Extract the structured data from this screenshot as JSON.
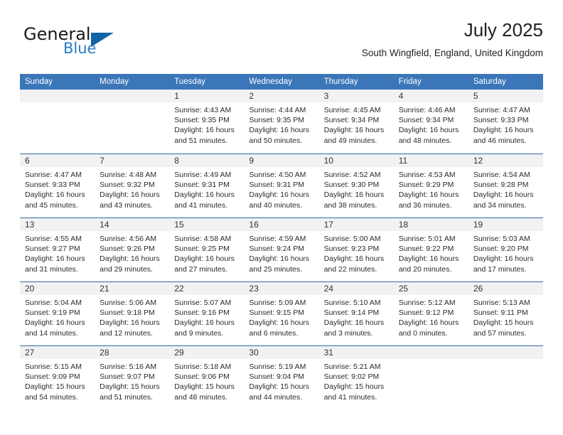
{
  "brand": {
    "name_part1": "General",
    "name_part2": "Blue"
  },
  "header": {
    "title": "July 2025",
    "subtitle": "South Wingfield, England, United Kingdom"
  },
  "colors": {
    "header_blue": "#3b76b9",
    "brand_blue": "#2b7cc4",
    "triangle_blue": "#1263a4",
    "numband_gray": "#f2f2f2",
    "week_rule": "#2e6aa8"
  },
  "weekdays": [
    "Sunday",
    "Monday",
    "Tuesday",
    "Wednesday",
    "Thursday",
    "Friday",
    "Saturday"
  ],
  "weeks": [
    [
      {
        "day": "",
        "sunrise": "",
        "sunset": "",
        "daylight1": "",
        "daylight2": ""
      },
      {
        "day": "",
        "sunrise": "",
        "sunset": "",
        "daylight1": "",
        "daylight2": ""
      },
      {
        "day": "1",
        "sunrise": "Sunrise: 4:43 AM",
        "sunset": "Sunset: 9:35 PM",
        "daylight1": "Daylight: 16 hours",
        "daylight2": "and 51 minutes."
      },
      {
        "day": "2",
        "sunrise": "Sunrise: 4:44 AM",
        "sunset": "Sunset: 9:35 PM",
        "daylight1": "Daylight: 16 hours",
        "daylight2": "and 50 minutes."
      },
      {
        "day": "3",
        "sunrise": "Sunrise: 4:45 AM",
        "sunset": "Sunset: 9:34 PM",
        "daylight1": "Daylight: 16 hours",
        "daylight2": "and 49 minutes."
      },
      {
        "day": "4",
        "sunrise": "Sunrise: 4:46 AM",
        "sunset": "Sunset: 9:34 PM",
        "daylight1": "Daylight: 16 hours",
        "daylight2": "and 48 minutes."
      },
      {
        "day": "5",
        "sunrise": "Sunrise: 4:47 AM",
        "sunset": "Sunset: 9:33 PM",
        "daylight1": "Daylight: 16 hours",
        "daylight2": "and 46 minutes."
      }
    ],
    [
      {
        "day": "6",
        "sunrise": "Sunrise: 4:47 AM",
        "sunset": "Sunset: 9:33 PM",
        "daylight1": "Daylight: 16 hours",
        "daylight2": "and 45 minutes."
      },
      {
        "day": "7",
        "sunrise": "Sunrise: 4:48 AM",
        "sunset": "Sunset: 9:32 PM",
        "daylight1": "Daylight: 16 hours",
        "daylight2": "and 43 minutes."
      },
      {
        "day": "8",
        "sunrise": "Sunrise: 4:49 AM",
        "sunset": "Sunset: 9:31 PM",
        "daylight1": "Daylight: 16 hours",
        "daylight2": "and 41 minutes."
      },
      {
        "day": "9",
        "sunrise": "Sunrise: 4:50 AM",
        "sunset": "Sunset: 9:31 PM",
        "daylight1": "Daylight: 16 hours",
        "daylight2": "and 40 minutes."
      },
      {
        "day": "10",
        "sunrise": "Sunrise: 4:52 AM",
        "sunset": "Sunset: 9:30 PM",
        "daylight1": "Daylight: 16 hours",
        "daylight2": "and 38 minutes."
      },
      {
        "day": "11",
        "sunrise": "Sunrise: 4:53 AM",
        "sunset": "Sunset: 9:29 PM",
        "daylight1": "Daylight: 16 hours",
        "daylight2": "and 36 minutes."
      },
      {
        "day": "12",
        "sunrise": "Sunrise: 4:54 AM",
        "sunset": "Sunset: 9:28 PM",
        "daylight1": "Daylight: 16 hours",
        "daylight2": "and 34 minutes."
      }
    ],
    [
      {
        "day": "13",
        "sunrise": "Sunrise: 4:55 AM",
        "sunset": "Sunset: 9:27 PM",
        "daylight1": "Daylight: 16 hours",
        "daylight2": "and 31 minutes."
      },
      {
        "day": "14",
        "sunrise": "Sunrise: 4:56 AM",
        "sunset": "Sunset: 9:26 PM",
        "daylight1": "Daylight: 16 hours",
        "daylight2": "and 29 minutes."
      },
      {
        "day": "15",
        "sunrise": "Sunrise: 4:58 AM",
        "sunset": "Sunset: 9:25 PM",
        "daylight1": "Daylight: 16 hours",
        "daylight2": "and 27 minutes."
      },
      {
        "day": "16",
        "sunrise": "Sunrise: 4:59 AM",
        "sunset": "Sunset: 9:24 PM",
        "daylight1": "Daylight: 16 hours",
        "daylight2": "and 25 minutes."
      },
      {
        "day": "17",
        "sunrise": "Sunrise: 5:00 AM",
        "sunset": "Sunset: 9:23 PM",
        "daylight1": "Daylight: 16 hours",
        "daylight2": "and 22 minutes."
      },
      {
        "day": "18",
        "sunrise": "Sunrise: 5:01 AM",
        "sunset": "Sunset: 9:22 PM",
        "daylight1": "Daylight: 16 hours",
        "daylight2": "and 20 minutes."
      },
      {
        "day": "19",
        "sunrise": "Sunrise: 5:03 AM",
        "sunset": "Sunset: 9:20 PM",
        "daylight1": "Daylight: 16 hours",
        "daylight2": "and 17 minutes."
      }
    ],
    [
      {
        "day": "20",
        "sunrise": "Sunrise: 5:04 AM",
        "sunset": "Sunset: 9:19 PM",
        "daylight1": "Daylight: 16 hours",
        "daylight2": "and 14 minutes."
      },
      {
        "day": "21",
        "sunrise": "Sunrise: 5:06 AM",
        "sunset": "Sunset: 9:18 PM",
        "daylight1": "Daylight: 16 hours",
        "daylight2": "and 12 minutes."
      },
      {
        "day": "22",
        "sunrise": "Sunrise: 5:07 AM",
        "sunset": "Sunset: 9:16 PM",
        "daylight1": "Daylight: 16 hours",
        "daylight2": "and 9 minutes."
      },
      {
        "day": "23",
        "sunrise": "Sunrise: 5:09 AM",
        "sunset": "Sunset: 9:15 PM",
        "daylight1": "Daylight: 16 hours",
        "daylight2": "and 6 minutes."
      },
      {
        "day": "24",
        "sunrise": "Sunrise: 5:10 AM",
        "sunset": "Sunset: 9:14 PM",
        "daylight1": "Daylight: 16 hours",
        "daylight2": "and 3 minutes."
      },
      {
        "day": "25",
        "sunrise": "Sunrise: 5:12 AM",
        "sunset": "Sunset: 9:12 PM",
        "daylight1": "Daylight: 16 hours",
        "daylight2": "and 0 minutes."
      },
      {
        "day": "26",
        "sunrise": "Sunrise: 5:13 AM",
        "sunset": "Sunset: 9:11 PM",
        "daylight1": "Daylight: 15 hours",
        "daylight2": "and 57 minutes."
      }
    ],
    [
      {
        "day": "27",
        "sunrise": "Sunrise: 5:15 AM",
        "sunset": "Sunset: 9:09 PM",
        "daylight1": "Daylight: 15 hours",
        "daylight2": "and 54 minutes."
      },
      {
        "day": "28",
        "sunrise": "Sunrise: 5:16 AM",
        "sunset": "Sunset: 9:07 PM",
        "daylight1": "Daylight: 15 hours",
        "daylight2": "and 51 minutes."
      },
      {
        "day": "29",
        "sunrise": "Sunrise: 5:18 AM",
        "sunset": "Sunset: 9:06 PM",
        "daylight1": "Daylight: 15 hours",
        "daylight2": "and 48 minutes."
      },
      {
        "day": "30",
        "sunrise": "Sunrise: 5:19 AM",
        "sunset": "Sunset: 9:04 PM",
        "daylight1": "Daylight: 15 hours",
        "daylight2": "and 44 minutes."
      },
      {
        "day": "31",
        "sunrise": "Sunrise: 5:21 AM",
        "sunset": "Sunset: 9:02 PM",
        "daylight1": "Daylight: 15 hours",
        "daylight2": "and 41 minutes."
      },
      {
        "day": "",
        "sunrise": "",
        "sunset": "",
        "daylight1": "",
        "daylight2": ""
      },
      {
        "day": "",
        "sunrise": "",
        "sunset": "",
        "daylight1": "",
        "daylight2": ""
      }
    ]
  ]
}
